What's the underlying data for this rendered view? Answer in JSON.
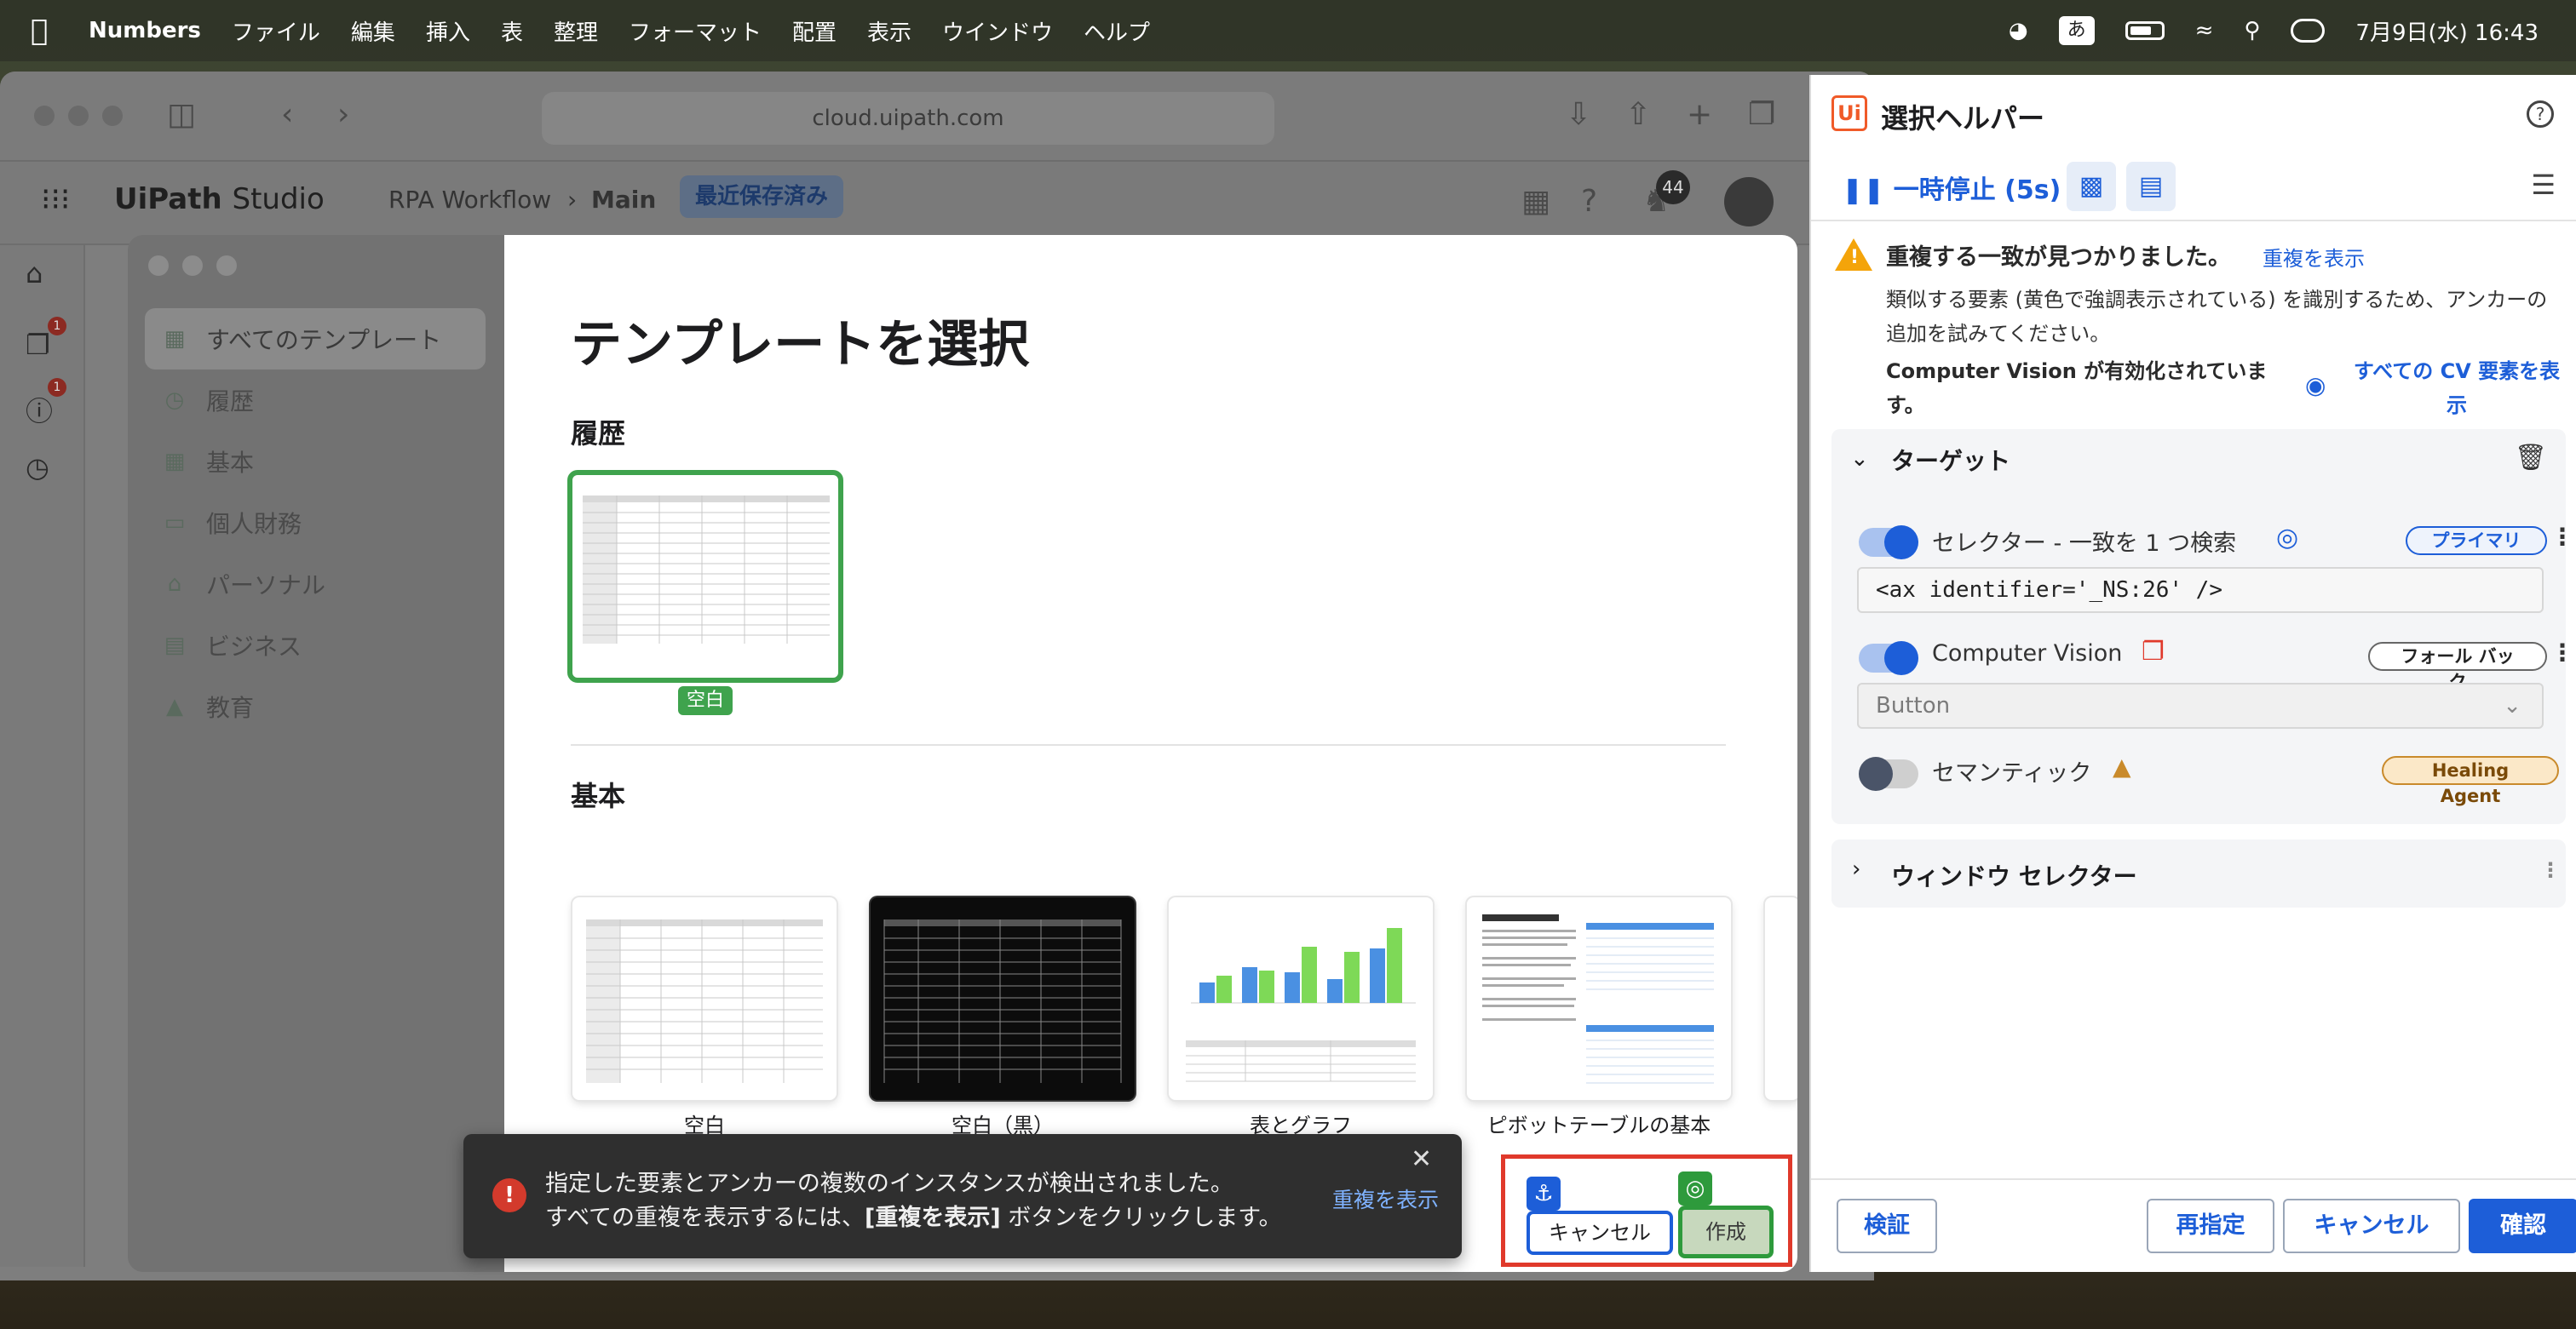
{
  "menubar": {
    "app_name": "Numbers",
    "items": [
      "ファイル",
      "編集",
      "挿入",
      "表",
      "整理",
      "フォーマット",
      "配置",
      "表示",
      "ウインドウ",
      "ヘルプ"
    ],
    "ime": "あ",
    "datetime": "7月9日(水) 16:43"
  },
  "browser": {
    "url": "cloud.uipath.com"
  },
  "studio": {
    "logo": "UiPath",
    "logo_suffix": "Studio",
    "breadcrumb_root": "RPA Workflow",
    "breadcrumb_current": "Main",
    "saved_badge": "最近保存済み",
    "notifications_count": "44",
    "sidebar_badges": [
      "1",
      "1"
    ]
  },
  "dialog": {
    "title": "テンプレートを選択",
    "categories": [
      {
        "label": "すべてのテンプレート",
        "icon": "grid-icon"
      },
      {
        "label": "履歴",
        "icon": "clock-icon"
      },
      {
        "label": "基本",
        "icon": "table-icon"
      },
      {
        "label": "個人財務",
        "icon": "wallet-icon"
      },
      {
        "label": "パーソナル",
        "icon": "house-icon"
      },
      {
        "label": "ビジネス",
        "icon": "briefcase-icon"
      },
      {
        "label": "教育",
        "icon": "graduation-cap-icon"
      }
    ],
    "recent_section": "履歴",
    "recent_item_label": "空白",
    "basic_section": "基本",
    "basic_items": [
      "空白",
      "空白（黒）",
      "表とグラフ",
      "ピボットテーブルの基本"
    ],
    "cancel_label": "キャンセル",
    "create_label": "作成"
  },
  "toast": {
    "line1": "指定した要素とアンカーの複数のインスタンスが検出されました。",
    "line2_pre": "すべての重複を表示するには、",
    "line2_bold": "[重複を表示]",
    "line2_post": " ボタンをクリックします。",
    "link": "重複を表示"
  },
  "panel": {
    "logo": "Ui",
    "title": "選択ヘルパー",
    "pause_label": "一時停止 (5s)",
    "warning_title": "重複する一致が見つかりました。",
    "warning_link": "重複を表示",
    "warning_text": "類似する要素 (黄色で強調表示されている) を識別するため、アンカーの追加を試みてください。",
    "cv_text": "Computer Vision が有効化されています。",
    "cv_link": "すべての CV 要素を表示",
    "target_title": "ターゲット",
    "selector_label": "セレクター - 一致を 1 つ検索",
    "selector_pill": "プライマリ",
    "selector_value": "<ax identifier='_NS:26' />",
    "cv_label": "Computer Vision",
    "cv_pill": "フォール バック",
    "cv_select": "Button",
    "semantic_label": "セマンティック",
    "semantic_pill": "Healing Agent",
    "window_selector_title": "ウィンドウ セレクター",
    "footer": {
      "validate": "検証",
      "reselect": "再指定",
      "cancel": "キャンセル",
      "confirm": "確認"
    }
  }
}
